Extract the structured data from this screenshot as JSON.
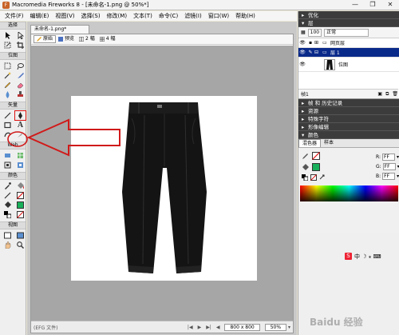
{
  "window": {
    "title": "Macromedia Fireworks 8 - [未命名-1.png @  50%*]",
    "minimize": "—",
    "restore": "❐",
    "close": "✕"
  },
  "menu": [
    "文件(F)",
    "编辑(E)",
    "视图(V)",
    "选择(S)",
    "修改(M)",
    "文本(T)",
    "命令(C)",
    "滤镜(I)",
    "窗口(W)",
    "帮助(H)"
  ],
  "tools": {
    "select_label": "选择",
    "bitmap_label": "位图",
    "vector_label": "矢量",
    "web_label": "Web",
    "color_label": "颜色",
    "view_label": "视图"
  },
  "document": {
    "tab_label": "未命名-1.png*",
    "views": [
      "原始",
      "预览",
      "2 幅",
      "4 幅"
    ],
    "status_left": "(EFG 文件)",
    "canvas_size": "800 x 800",
    "zoom": "50%"
  },
  "panels": {
    "optimize": "优化",
    "layers": "层",
    "opacity_value": "100",
    "blend_mode": "正常",
    "web_layer": "网页层",
    "layer1": "层 1",
    "bitmap": "位图",
    "frame_label": "帧1",
    "frames": "帧 和 历史记录",
    "assets": "资源",
    "special_chars": "特殊字符",
    "image_edit": "形像编辑",
    "color": "颜色",
    "mixer_tab": "混色器",
    "swatches_tab": "样本",
    "r_label": "R:",
    "g_label": "G:",
    "b_label": "B:",
    "r_value": "FF",
    "g_value": "FF",
    "b_value": "FF",
    "ime_text": "中 ☽ ⁎ ⌨"
  },
  "colors": {
    "accent_red": "#d11a1a",
    "layer_selected": "#0a2a8a",
    "panel_header": "#3c3c3c",
    "fill_swatch": "#18b05a"
  },
  "watermark": "Baidu 经验"
}
